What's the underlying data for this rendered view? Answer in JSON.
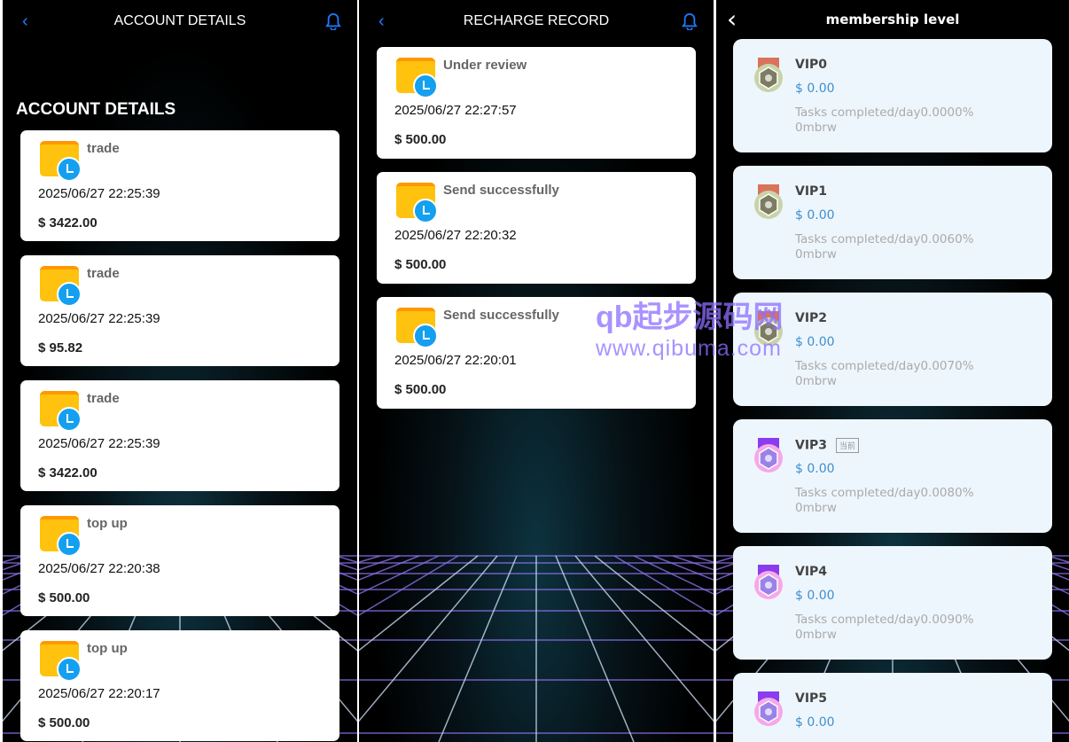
{
  "account": {
    "title": "ACCOUNT DETAILS",
    "section": "ACCOUNT DETAILS",
    "items": [
      {
        "type": "trade",
        "date": "2025/06/27 22:25:39",
        "amount": "$ 3422.00"
      },
      {
        "type": "trade",
        "date": "2025/06/27 22:25:39",
        "amount": "$ 95.82"
      },
      {
        "type": "trade",
        "date": "2025/06/27 22:25:39",
        "amount": "$ 3422.00"
      },
      {
        "type": "top up",
        "date": "2025/06/27 22:20:38",
        "amount": "$ 500.00"
      },
      {
        "type": "top up",
        "date": "2025/06/27 22:20:17",
        "amount": "$ 500.00"
      }
    ]
  },
  "recharge": {
    "title": "RECHARGE RECORD",
    "items": [
      {
        "status": "Under review",
        "date": "2025/06/27 22:27:57",
        "amount": "$ 500.00"
      },
      {
        "status": "Send successfully",
        "date": "2025/06/27 22:20:32",
        "amount": "$ 500.00"
      },
      {
        "status": "Send successfully",
        "date": "2025/06/27 22:20:01",
        "amount": "$ 500.00"
      }
    ]
  },
  "membership": {
    "title": "membership level",
    "current_badge": "当前",
    "levels": [
      {
        "name": "VIP0",
        "amount": "$ 0.00",
        "tasks": "Tasks completed/day0.0000%",
        "unit": "0mbrw"
      },
      {
        "name": "VIP1",
        "amount": "$ 0.00",
        "tasks": "Tasks completed/day0.0060%",
        "unit": "0mbrw"
      },
      {
        "name": "VIP2",
        "amount": "$ 0.00",
        "tasks": "Tasks completed/day0.0070%",
        "unit": "0mbrw"
      },
      {
        "name": "VIP3",
        "amount": "$ 0.00",
        "tasks": "Tasks completed/day0.0080%",
        "unit": "0mbrw"
      },
      {
        "name": "VIP4",
        "amount": "$ 0.00",
        "tasks": "Tasks completed/day0.0090%",
        "unit": "0mbrw"
      },
      {
        "name": "VIP5",
        "amount": "$ 0.00"
      }
    ]
  },
  "watermark": {
    "line1": "qb起步源码网",
    "line2": "www.qibuma.com"
  },
  "colors": {
    "accent": "#1e7bff",
    "amount_blue": "#3d8fd0"
  }
}
